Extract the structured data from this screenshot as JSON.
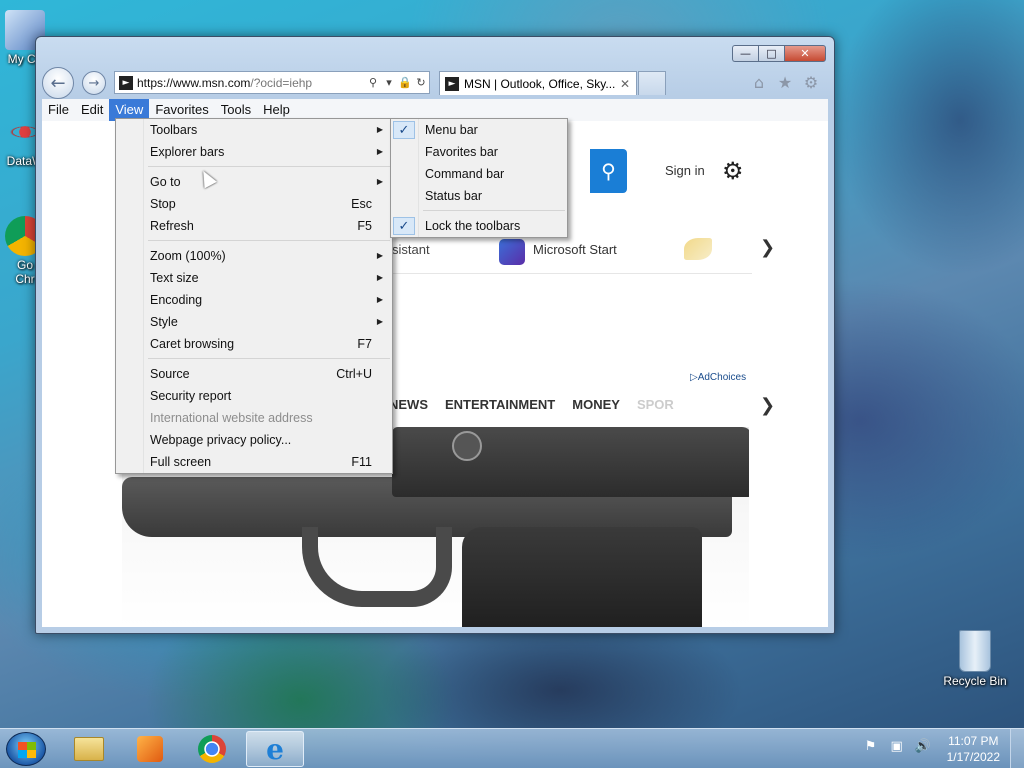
{
  "desktop": {
    "icons": [
      {
        "label": "My Co"
      },
      {
        "label": "DataW"
      },
      {
        "label": "Go\nChr"
      },
      {
        "label": "Recycle Bin"
      }
    ]
  },
  "browser": {
    "address": {
      "host": "https://www.msn.com",
      "rest": "/?ocid=iehp"
    },
    "tab_title": "MSN | Outlook, Office, Sky...",
    "menubar": [
      "File",
      "Edit",
      "View",
      "Favorites",
      "Tools",
      "Help"
    ]
  },
  "page": {
    "sign_in": "Sign in",
    "assistant": "sistant",
    "microsoft_start": "Microsoft Start",
    "adchoices": "AdChoices",
    "categories": [
      "NEWS",
      "ENTERTAINMENT",
      "MONEY",
      "SPOR"
    ]
  },
  "view_menu": {
    "items": [
      {
        "label": "Toolbars",
        "submenu": true
      },
      {
        "label": "Explorer bars",
        "submenu": true
      },
      {
        "sep": true
      },
      {
        "label": "Go to",
        "submenu": true
      },
      {
        "label": "Stop",
        "shortcut": "Esc"
      },
      {
        "label": "Refresh",
        "shortcut": "F5"
      },
      {
        "sep": true
      },
      {
        "label": "Zoom (100%)",
        "submenu": true
      },
      {
        "label": "Text size",
        "submenu": true
      },
      {
        "label": "Encoding",
        "submenu": true
      },
      {
        "label": "Style",
        "submenu": true
      },
      {
        "label": "Caret browsing",
        "shortcut": "F7"
      },
      {
        "sep": true
      },
      {
        "label": "Source",
        "shortcut": "Ctrl+U"
      },
      {
        "label": "Security report"
      },
      {
        "label": "International website address",
        "disabled": true
      },
      {
        "label": "Webpage privacy policy..."
      },
      {
        "label": "Full screen",
        "shortcut": "F11"
      }
    ]
  },
  "toolbars_menu": {
    "items": [
      {
        "label": "Menu bar",
        "checked": true
      },
      {
        "label": "Favorites bar"
      },
      {
        "label": "Command bar"
      },
      {
        "label": "Status bar"
      },
      {
        "sep": true
      },
      {
        "label": "Lock the toolbars",
        "checked": true
      }
    ]
  },
  "taskbar": {
    "time": "11:07 PM",
    "date": "1/17/2022"
  }
}
